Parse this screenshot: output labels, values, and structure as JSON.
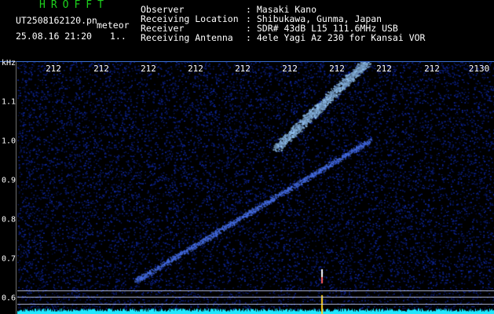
{
  "header": {
    "logo": "HROFFT",
    "filename": "UT2508162120.pn",
    "tag": "meteor",
    "datetime": "25.08.16 21:20",
    "page_indicator": "1..",
    "fields": [
      {
        "label": "Observer",
        "value": ": Masaki Kano"
      },
      {
        "label": "Receiving Location",
        "value": ": Shibukawa, Gunma, Japan"
      },
      {
        "label": "Receiver",
        "value": ": SDR# 43dB L15 111.6MHz USB"
      },
      {
        "label": "Receiving Antenna",
        "value": ": 4ele Yagi Az 230 for Kansai VOR"
      }
    ]
  },
  "time_axis": {
    "ticks": [
      "212",
      "212",
      "212",
      "212",
      "212",
      "212",
      "212",
      "212",
      "212",
      "2130"
    ]
  },
  "freq_axis": {
    "unit": "kHz",
    "ticks": [
      "1.1",
      "1.0",
      "0.9",
      "0.8",
      "0.7",
      "0.6"
    ]
  },
  "colors": {
    "background": "#000000",
    "noise": "#0b1e78",
    "echo": "#7fb7ff",
    "baseline": "#20e8ff",
    "marker": "#ffd21a"
  }
}
